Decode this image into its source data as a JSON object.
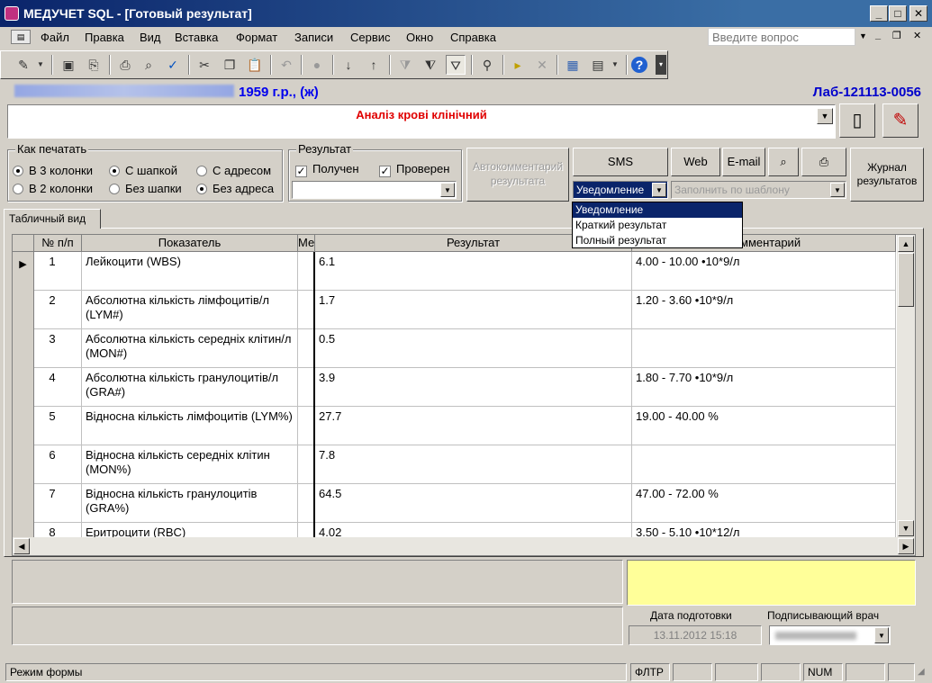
{
  "window": {
    "title": "МЕДУЧЕТ SQL - [Готовый результат]",
    "controls": [
      "_",
      "□",
      "✕"
    ]
  },
  "menu": {
    "items": [
      "Файл",
      "Правка",
      "Вид",
      "Вставка",
      "Формат",
      "Записи",
      "Сервис",
      "Окно",
      "Справка"
    ],
    "ask_placeholder": "Введите вопрос"
  },
  "patient": {
    "year_sex": "1959 г.р., (ж)",
    "lab_number": "Лаб-121113-0056"
  },
  "analysis": {
    "title": "Аналіз крові клінічний"
  },
  "print_group": {
    "legend": "Как печатать",
    "options": [
      {
        "label": "В 3 колонки",
        "checked": true
      },
      {
        "label": "С шапкой",
        "checked": true
      },
      {
        "label": "С адресом",
        "checked": false
      },
      {
        "label": "В 2 колонки",
        "checked": false
      },
      {
        "label": "Без шапки",
        "checked": false
      },
      {
        "label": "Без адреса",
        "checked": true
      }
    ]
  },
  "result_group": {
    "legend": "Результат",
    "received_label": "Получен",
    "checked_label": "Проверен",
    "received": true,
    "checked": true,
    "combo_value": ""
  },
  "buttons": {
    "autocomment": "Автокомментарий результата",
    "sms": "SMS",
    "web": "Web",
    "email": "E-mail",
    "journal": "Журнал результатов"
  },
  "notify": {
    "value": "Уведомление",
    "options": [
      "Уведомление",
      "Краткий результат",
      "Полный результат"
    ],
    "template_placeholder": "Заполнить по шаблону"
  },
  "tab": {
    "label": "Табличный вид"
  },
  "grid": {
    "columns": [
      "№ п/п",
      "Показатель",
      "Ме",
      "Результат",
      "мментарий"
    ],
    "rows": [
      {
        "n": "1",
        "name": "Лейкоцити (WBS)",
        "result": "6.1",
        "norm": "4.00 - 10.00 •10*9/л"
      },
      {
        "n": "2",
        "name": "Абсолютна кількість лімфоцитів/л (LYM#)",
        "result": "1.7",
        "norm": "1.20 - 3.60 •10*9/л"
      },
      {
        "n": "3",
        "name": "Абсолютна кількість середніх клітин/л (MON#)",
        "result": "0.5",
        "norm": ""
      },
      {
        "n": "4",
        "name": "Абсолютна кількість гранулоцитів/л (GRA#)",
        "result": "3.9",
        "norm": "1.80 - 7.70 •10*9/л"
      },
      {
        "n": "5",
        "name": "Відносна кількість лімфоцитів (LYM%)",
        "result": "27.7",
        "norm": "19.00 - 40.00 %"
      },
      {
        "n": "6",
        "name": "Відносна кількість середніх клітин (MON%)",
        "result": "7.8",
        "norm": ""
      },
      {
        "n": "7",
        "name": "Відносна кількість гранулоцитів (GRA%)",
        "result": "64.5",
        "norm": "47.00 - 72.00 %"
      },
      {
        "n": "8",
        "name": "Еритроцити (RBC)",
        "result": "4.02",
        "norm": "3.50 - 5.10 •10*12/л"
      }
    ]
  },
  "footer": {
    "date_label": "Дата подготовки",
    "date_value": "13.11.2012 15:18",
    "doctor_label": "Подписывающий врач"
  },
  "status": {
    "mode": "Режим формы",
    "filter": "ФЛТР",
    "num": "NUM"
  }
}
